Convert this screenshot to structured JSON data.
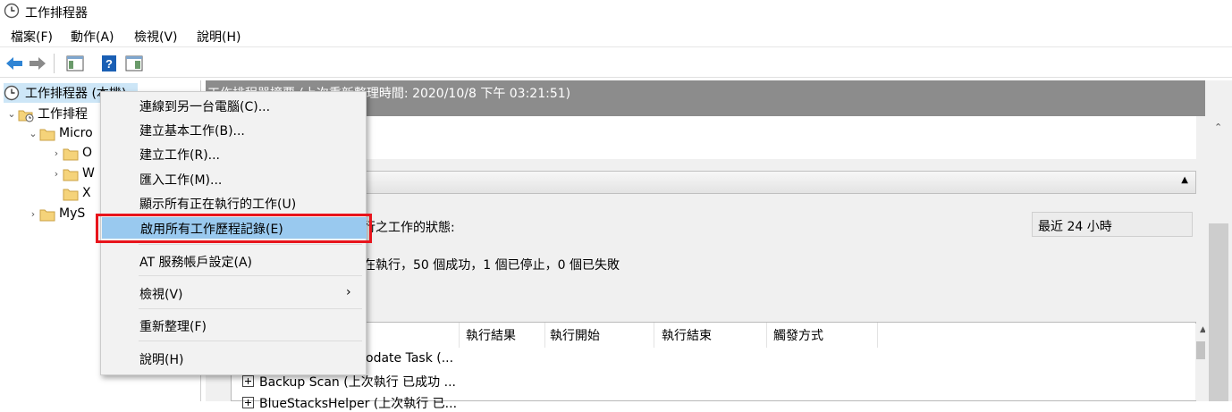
{
  "window": {
    "title": "工作排程器"
  },
  "menubar": {
    "items": [
      "檔案(F)",
      "動作(A)",
      "檢視(V)",
      "說明(H)"
    ]
  },
  "toolbar": {
    "icons": [
      "back-arrow-icon",
      "forward-arrow-icon",
      "show-hide-tree-icon",
      "help-icon",
      "show-hide-action-pane-icon"
    ],
    "colors": {
      "arrow": "#2f84d4",
      "help": "#1a5fb4"
    }
  },
  "tree": {
    "root": "工作排程器 (本機)",
    "library": "工作排程",
    "microsoft": "Micro",
    "children": [
      "O",
      "W",
      "X"
    ],
    "mys": "MyS"
  },
  "summary": {
    "header": "工作排程器摘要 (上次重新整理時間: 2020/10/8 下午 03:21:51)",
    "status_label": "行之工作的狀態:",
    "status_counts": "在執行，50 個成功，1 個已停止，0 個已失敗",
    "range_selected": "最近 24 小時"
  },
  "table": {
    "columns": [
      "執行結果",
      "執行開始",
      "執行結束",
      "觸發方式"
    ],
    "rows": [
      "odate Task (...",
      "Backup Scan (上次執行 已成功 ...",
      "BlueStacksHelper (上次執行 已..."
    ]
  },
  "context_menu": {
    "items": [
      "連線到另一台電腦(C)...",
      "建立基本工作(B)...",
      "建立工作(R)...",
      "匯入工作(M)...",
      "顯示所有正在執行的工作(U)",
      "啟用所有工作歷程記錄(E)",
      "AT 服務帳戶設定(A)",
      "檢視(V)",
      "重新整理(F)",
      "說明(H)"
    ],
    "submenu_arrow": "›",
    "highlight_color": "#99c9ef",
    "annotation_color": "#e8141c"
  }
}
